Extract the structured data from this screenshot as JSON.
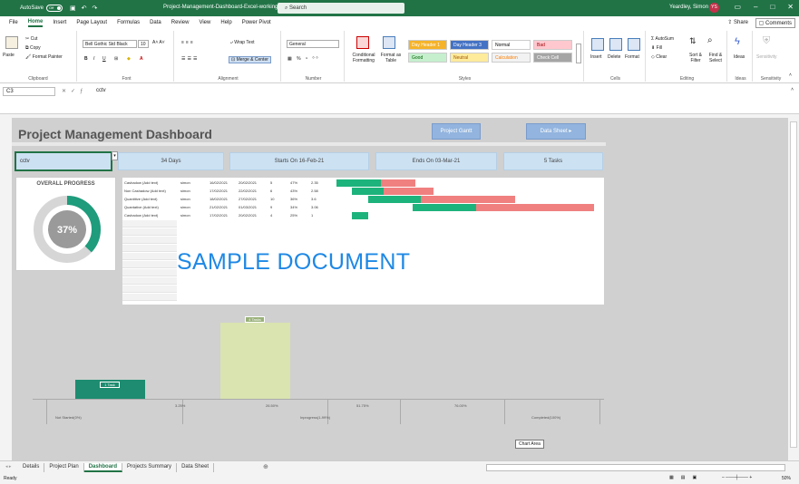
{
  "titlebar": {
    "autosave_label": "AutoSave",
    "autosave_state": "Off",
    "document_title": "Project-Management-Dashboard-Excel-working copy",
    "search_placeholder": "Search",
    "user_name": "Yeardley, Simon",
    "user_initials": "YS",
    "qat": [
      "save-icon",
      "undo-icon",
      "redo-icon"
    ]
  },
  "menu": {
    "tabs": [
      "File",
      "Home",
      "Insert",
      "Page Layout",
      "Formulas",
      "Data",
      "Review",
      "View",
      "Help",
      "Power Pivot"
    ],
    "active": "Home",
    "share": "Share",
    "comments": "Comments"
  },
  "ribbon": {
    "clipboard": {
      "paste": "Paste",
      "cut": "Cut",
      "copy": "Copy",
      "format_painter": "Format Painter",
      "label": "Clipboard"
    },
    "font": {
      "name": "Bell Gothic Std Black",
      "size": "10",
      "bold": "B",
      "italic": "I",
      "underline": "U",
      "label": "Font"
    },
    "alignment": {
      "wrap": "Wrap Text",
      "merge": "Merge & Center",
      "label": "Alignment"
    },
    "number": {
      "format": "General",
      "label": "Number"
    },
    "styles": {
      "conditional": "Conditional Formatting",
      "format_as_table": "Format as Table",
      "cells": [
        {
          "text": "Day Header 1",
          "bg": "#f5b32a",
          "fg": "#ffffff"
        },
        {
          "text": "Day Header 3",
          "bg": "#4472c4",
          "fg": "#ffffff"
        },
        {
          "text": "Normal",
          "bg": "#ffffff",
          "fg": "#000000"
        },
        {
          "text": "Bad",
          "bg": "#ffc7ce",
          "fg": "#9c0006"
        },
        {
          "text": "Good",
          "bg": "#c6efce",
          "fg": "#006100"
        },
        {
          "text": "Neutral",
          "bg": "#ffeb9c",
          "fg": "#9c5700"
        },
        {
          "text": "Calculation",
          "bg": "#f2f2f2",
          "fg": "#fa7d00"
        },
        {
          "text": "Check Cell",
          "bg": "#a5a5a5",
          "fg": "#ffffff"
        }
      ],
      "label": "Styles"
    },
    "cells": {
      "insert": "Insert",
      "delete": "Delete",
      "format": "Format",
      "label": "Cells"
    },
    "editing": {
      "autosum": "AutoSum",
      "fill": "Fill",
      "clear": "Clear",
      "sort": "Sort & Filter",
      "find": "Find & Select",
      "label": "Editing"
    },
    "ideas": {
      "text": "Ideas",
      "label": "Ideas"
    },
    "sensitivity": {
      "text": "Sensitivity",
      "label": "Sensitivity"
    }
  },
  "formula_bar": {
    "cell": "C3",
    "value": "cctv"
  },
  "dashboard": {
    "title": "Project Management Dashboard",
    "btn_gantt": "Project Gantt",
    "btn_datasheet": "Data Sheet",
    "filter_value": "cctv",
    "kpis": [
      "34 Days",
      "Starts On 16-Feb-21",
      "Ends On 03-Mar-21",
      "5 Tasks"
    ],
    "overall_progress_label": "OVERALL PROGRESS",
    "overall_progress_pct": "37%",
    "overall_progress_value": 0.37,
    "watermark": "SAMPLE DOCUMENT",
    "chart_area_label": "Chart Area"
  },
  "tasks": [
    {
      "name": "Cashadow (Add text)",
      "owner": "simon",
      "start": "16/02/2021",
      "end": "20/02/2021",
      "days": "5",
      "pct": "47%",
      "val": "2.35"
    },
    {
      "name": "Non Cashadow (Add text)",
      "owner": "simon",
      "start": "17/02/2021",
      "end": "22/02/2021",
      "days": "6",
      "pct": "43%",
      "val": "2.58"
    },
    {
      "name": "Quantitive (Add text)",
      "owner": "simon",
      "start": "18/02/2021",
      "end": "27/02/2021",
      "days": "10",
      "pct": "36%",
      "val": "3.6"
    },
    {
      "name": "Quantative (Add text)",
      "owner": "simon",
      "start": "21/02/2021",
      "end": "01/03/2021",
      "days": "9",
      "pct": "34%",
      "val": "3.06"
    },
    {
      "name": "Cashadow (Add text)",
      "owner": "simon",
      "start": "17/02/2021",
      "end": "20/02/2021",
      "days": "4",
      "pct": "25%",
      "val": "1"
    }
  ],
  "gantt": [
    {
      "start": 0.0,
      "done": 0.17,
      "remaining": 0.13
    },
    {
      "start": 0.06,
      "done": 0.12,
      "remaining": 0.19
    },
    {
      "start": 0.12,
      "done": 0.2,
      "remaining": 0.36
    },
    {
      "start": 0.29,
      "done": 0.24,
      "remaining": 0.45
    },
    {
      "start": 0.06,
      "done": 0.06,
      "remaining": 0.0
    }
  ],
  "chart_data": {
    "type": "bar",
    "categories": [
      "Not Started(0%)",
      "Inprogress(1-99%)",
      "Completed(100%)"
    ],
    "values": [
      1,
      4,
      0
    ],
    "data_labels": [
      "1 Task",
      "4 Tasks",
      ""
    ],
    "segment_labels": [
      "3.25%",
      "26.50%",
      "51.75%",
      "76.00%"
    ],
    "ylim": [
      0,
      4.5
    ],
    "colors": [
      "#1e8c70",
      "#d9e4b0",
      "#d9e4b0"
    ]
  },
  "sheets": [
    "Details",
    "Project Plan",
    "Dashboard",
    "Projects Summary",
    "Data Sheet"
  ],
  "active_sheet": "Dashboard",
  "status": {
    "mode": "Ready",
    "zoom": "50%"
  }
}
